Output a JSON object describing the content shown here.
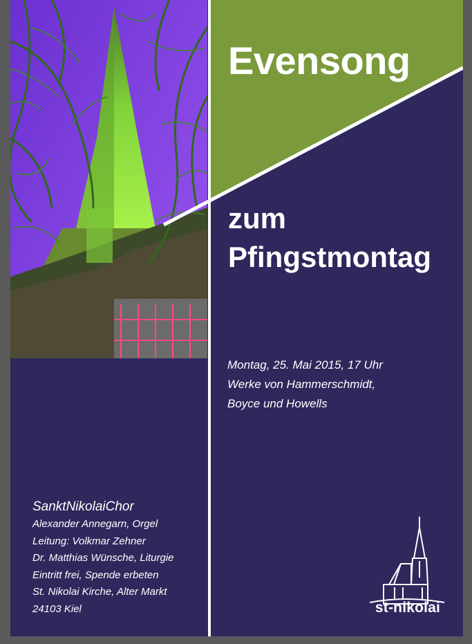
{
  "poster": {
    "title": "Evensong",
    "subtitle_line1": "zum",
    "subtitle_line2": "Pfingstmontag",
    "details": [
      "Montag, 25. Mai 2015, 17 Uhr",
      "Werke von Hammerschmidt,",
      "Boyce und Howells"
    ],
    "credits": {
      "choir": "SanktNikolaiChor",
      "lines": [
        "Alexander Annegarn, Orgel",
        "Leitung: Volkmar Zehner",
        "Dr. Matthias Wünsche, Liturgie",
        "Eintritt frei, Spende erbeten",
        "St. Nikolai Kirche, Alter Markt",
        "24103 Kiel"
      ]
    },
    "logo_text": "st-nikolai",
    "colors": {
      "navy": "#2e285c",
      "olive_green": "#7b9a3c",
      "photo_sky": "#7a3fd8",
      "photo_spire": "#8ee63a",
      "white": "#ffffff",
      "frame": "#5a5a5a"
    },
    "icons": [
      "church-photo",
      "church-spire-logo-icon"
    ]
  }
}
